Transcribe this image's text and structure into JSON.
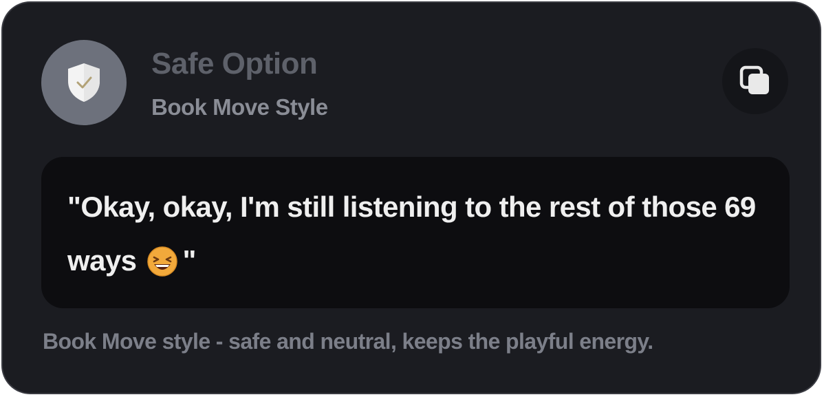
{
  "header": {
    "title": "Safe Option",
    "subtitle": "Book Move Style",
    "badge_icon": "shield-check-icon",
    "copy_icon": "copy-icon"
  },
  "quote": {
    "text_before": "\"Okay, okay, I'm still listening to the rest of those 69 ways",
    "emoji": "grinning-squinting-face-emoji",
    "text_after": "\""
  },
  "description": "Book Move style - safe and neutral, keeps the playful energy.",
  "colors": {
    "card_background": "#1b1c21",
    "quote_background": "#0d0d10",
    "badge_background": "#6d717c",
    "shield": "#f3f3f3",
    "emoji": "#f2a93b"
  }
}
